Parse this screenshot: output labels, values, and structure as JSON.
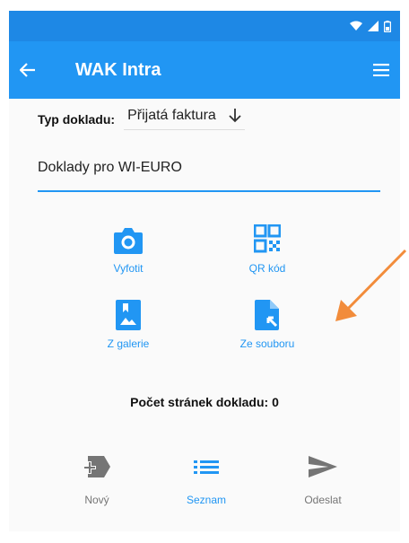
{
  "app": {
    "title": "WAK Intra"
  },
  "form": {
    "typ_label": "Typ dokladu:",
    "typ_value": "Přijatá faktura",
    "description_value": "Doklady pro WI-EURO"
  },
  "actions": {
    "camera": "Vyfotit",
    "qr": "QR kód",
    "gallery": "Z galerie",
    "file": "Ze souboru"
  },
  "status": {
    "page_count": "Počet stránek dokladu: 0"
  },
  "bottom_nav": {
    "new": "Nový",
    "list": "Seznam",
    "send": "Odeslat"
  },
  "colors": {
    "primary": "#2196f3",
    "status_bar": "#1e88e5",
    "annotation_arrow": "#f28c3b",
    "inactive": "#757575"
  },
  "icons": {
    "camera": "camera-icon",
    "qr": "qr-code-icon",
    "gallery": "image-icon",
    "file": "file-import-icon",
    "new": "add-document-icon",
    "list": "list-icon",
    "send": "send-icon"
  }
}
